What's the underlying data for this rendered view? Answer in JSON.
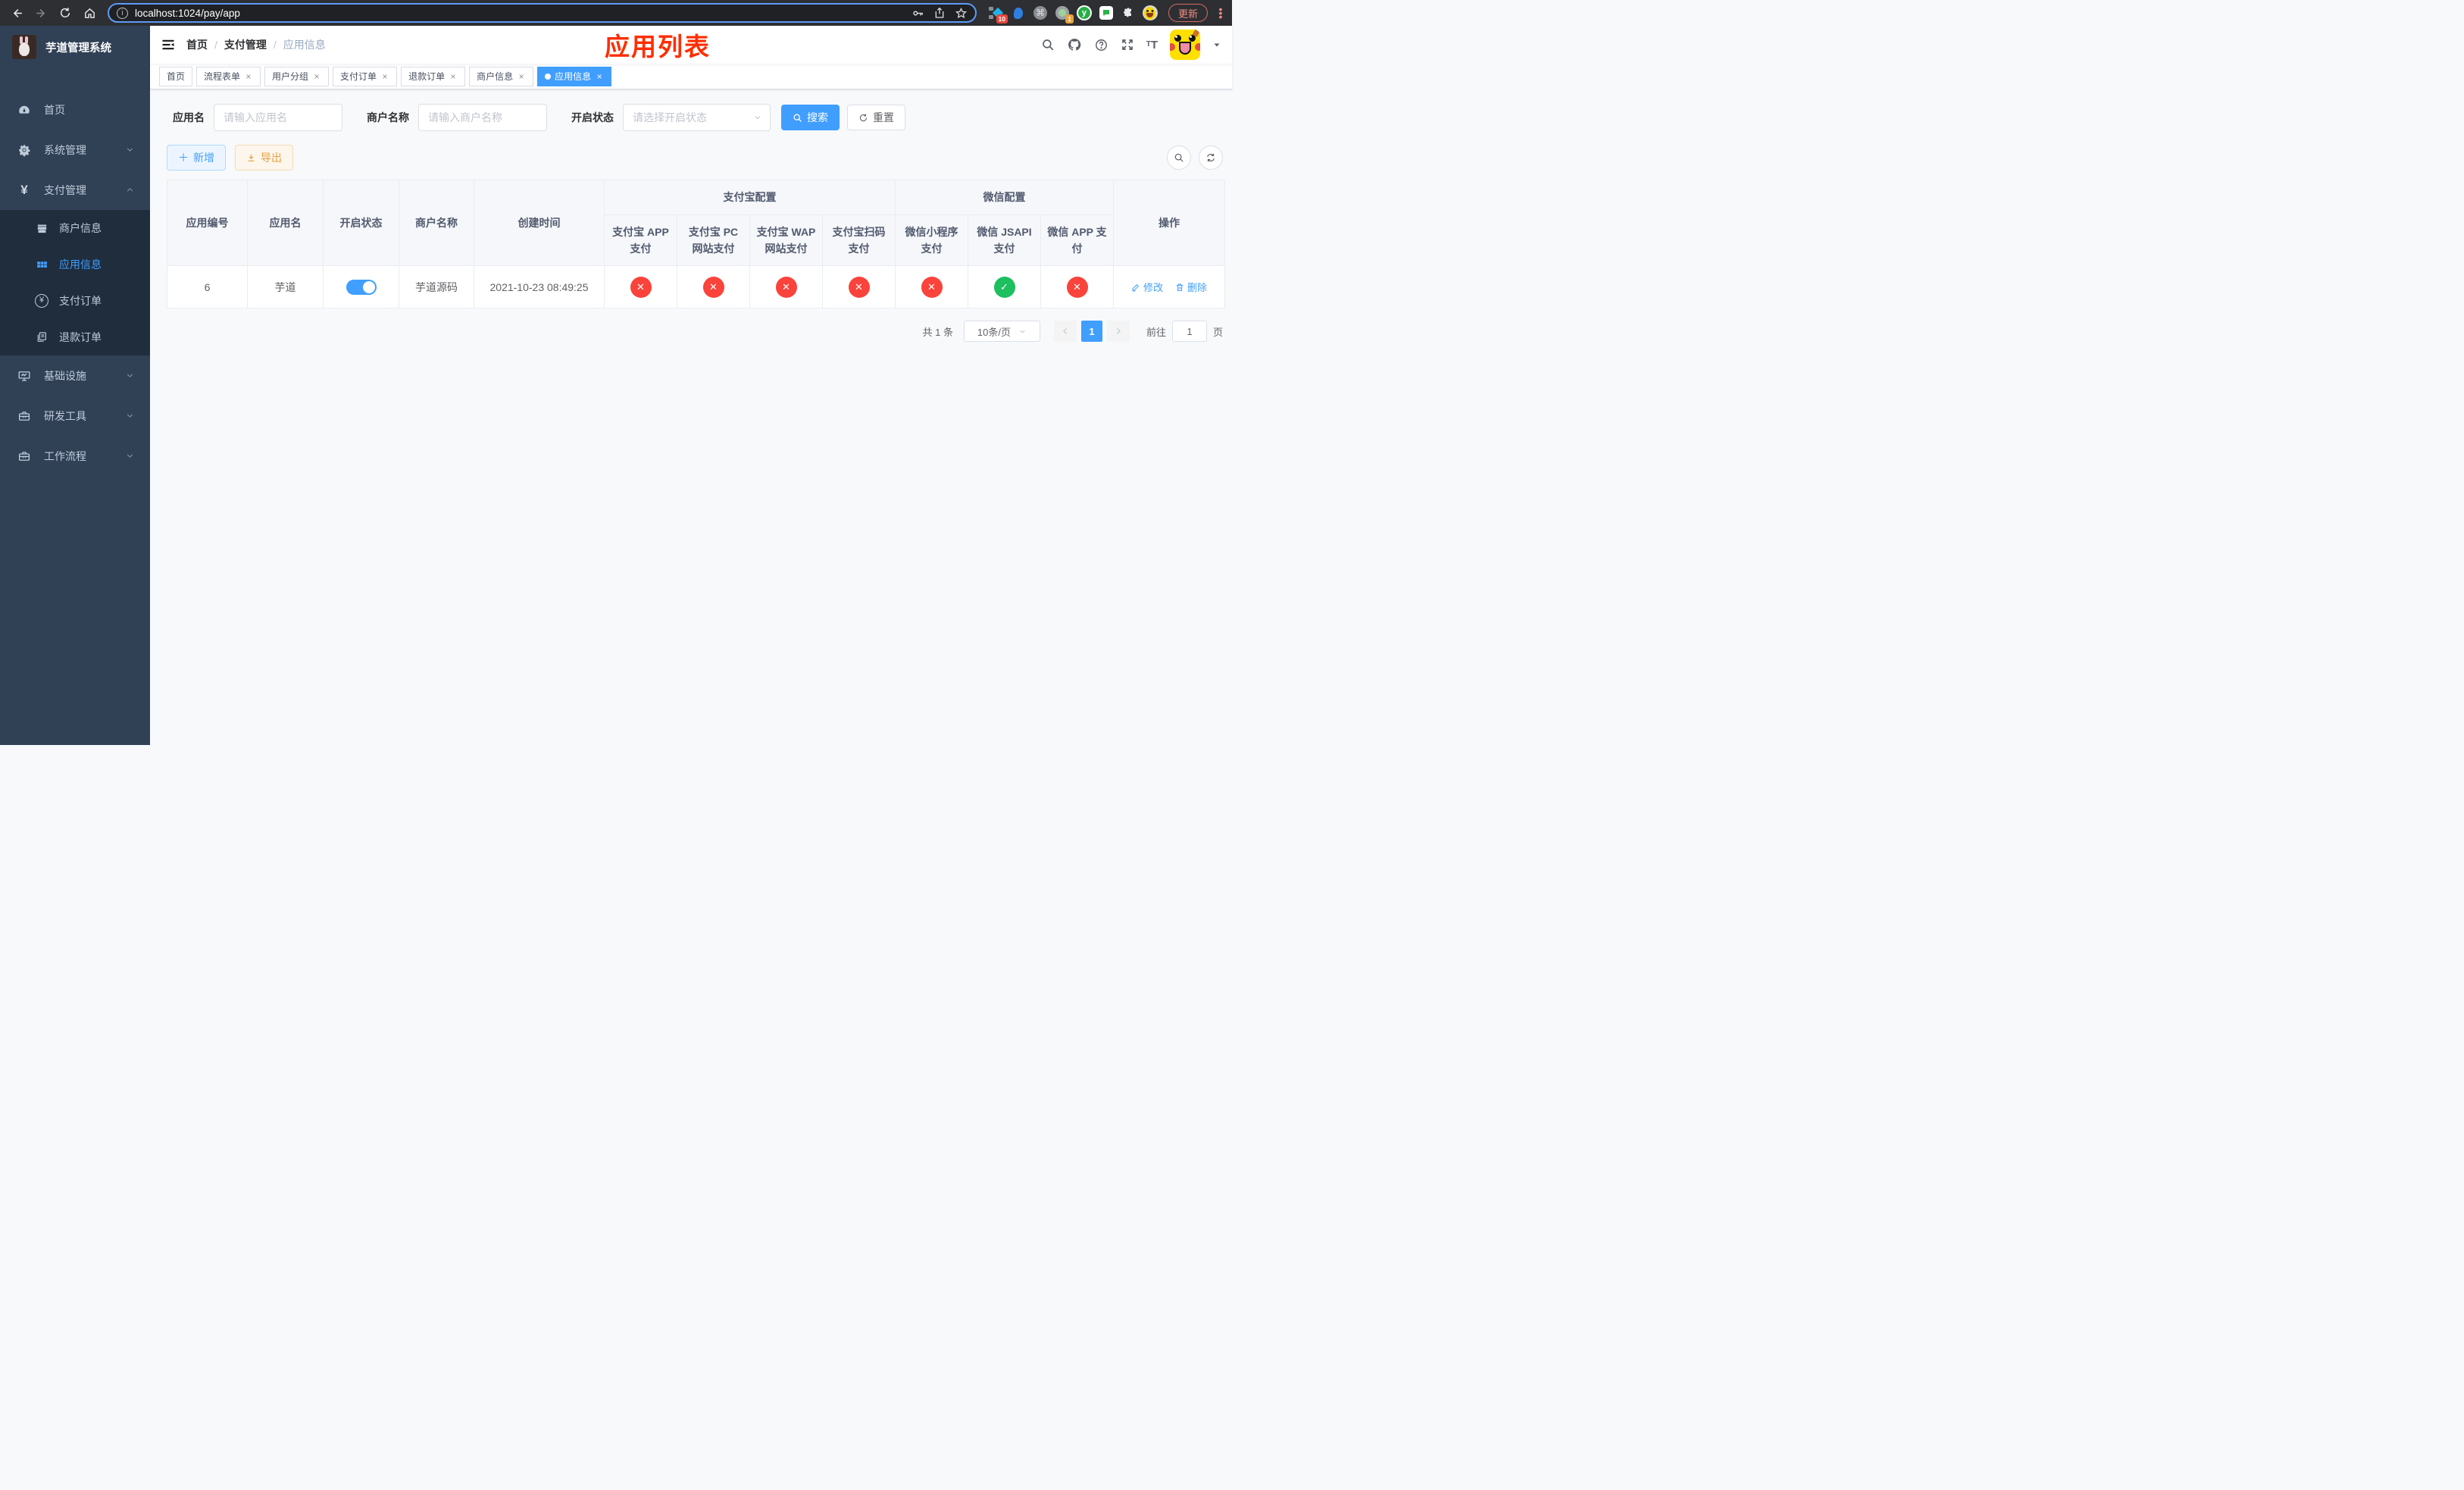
{
  "browser": {
    "url": "localhost:1024/pay/app",
    "update_button": "更新",
    "extension_badges": {
      "first": "10",
      "second": "1"
    }
  },
  "sidebar": {
    "title": "芋道管理系统",
    "items": [
      {
        "label": "首页"
      },
      {
        "label": "系统管理"
      },
      {
        "label": "支付管理",
        "children": [
          {
            "label": "商户信息"
          },
          {
            "label": "应用信息"
          },
          {
            "label": "支付订单"
          },
          {
            "label": "退款订单"
          }
        ]
      },
      {
        "label": "基础设施"
      },
      {
        "label": "研发工具"
      },
      {
        "label": "工作流程"
      }
    ]
  },
  "header": {
    "breadcrumb": [
      "首页",
      "支付管理",
      "应用信息"
    ],
    "separator": "/",
    "annotation": "应用列表"
  },
  "tabs": [
    {
      "label": "首页"
    },
    {
      "label": "流程表单"
    },
    {
      "label": "用户分组"
    },
    {
      "label": "支付订单"
    },
    {
      "label": "退款订单"
    },
    {
      "label": "商户信息"
    },
    {
      "label": "应用信息"
    }
  ],
  "filters": {
    "app_name_label": "应用名",
    "app_name_placeholder": "请输入应用名",
    "merchant_label": "商户名称",
    "merchant_placeholder": "请输入商户名称",
    "status_label": "开启状态",
    "status_placeholder": "请选择开启状态",
    "search_button": "搜索",
    "reset_button": "重置"
  },
  "toolbar": {
    "add_button": "新增",
    "export_button": "导出"
  },
  "table": {
    "columns": {
      "id": "应用编号",
      "name": "应用名",
      "status": "开启状态",
      "merchant": "商户名称",
      "created": "创建时间",
      "alipay_group": "支付宝配置",
      "wechat_group": "微信配置",
      "alipay_app": "支付宝 APP 支付",
      "alipay_pc": "支付宝 PC 网站支付",
      "alipay_wap": "支付宝 WAP 网站支付",
      "alipay_qr": "支付宝扫码支付",
      "wx_lite": "微信小程序支付",
      "wx_jsapi": "微信 JSAPI 支付",
      "wx_app": "微信 APP 支付",
      "ops": "操作"
    },
    "row": {
      "id": "6",
      "name": "芋道",
      "enabled": true,
      "merchant": "芋道源码",
      "created": "2021-10-23 08:49:25",
      "channels": [
        false,
        false,
        false,
        false,
        false,
        true,
        false
      ],
      "edit_label": "修改",
      "delete_label": "删除"
    }
  },
  "icons": {
    "success": "✓",
    "fail": "✕"
  },
  "pagination": {
    "total": "共 1 条",
    "page_size": "10条/页",
    "page": "1",
    "goto_prefix": "前往",
    "goto_suffix": "页",
    "goto_value": "1"
  },
  "colors": {
    "accent": "#409eff",
    "success": "#1dbf5f",
    "danger": "#f9433b",
    "warning": "#e6a23c",
    "sidebar_bg": "#304156",
    "annotation": "#ff2d00"
  }
}
